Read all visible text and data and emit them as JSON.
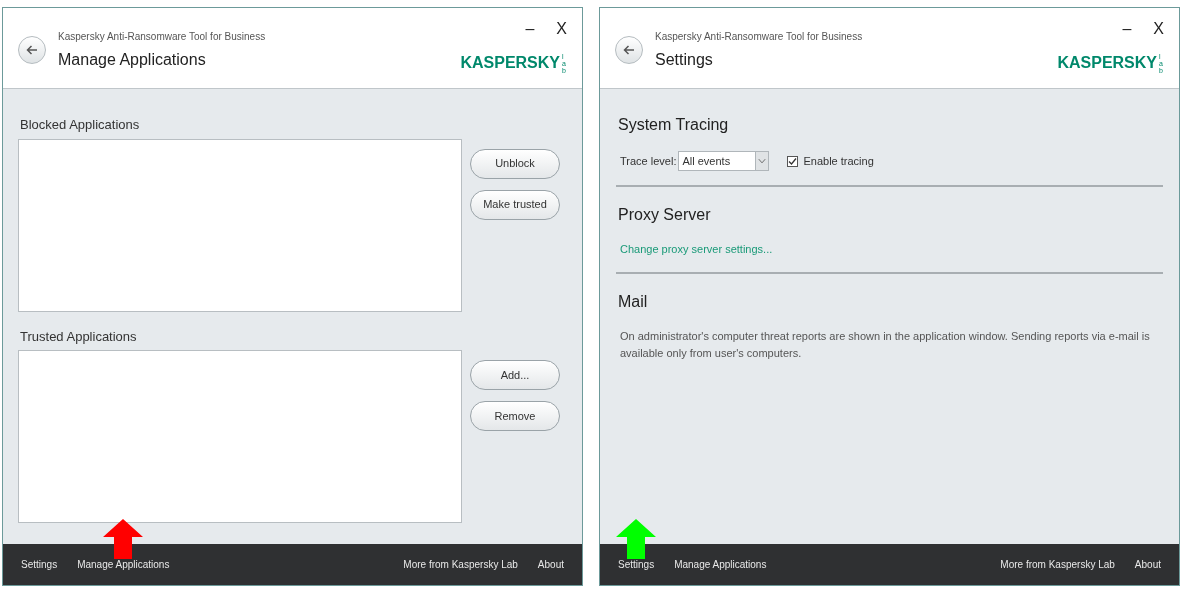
{
  "windows": [
    {
      "kind": "manage",
      "app_name": "Kaspersky Anti-Ransomware Tool for Business",
      "title": "Manage Applications",
      "logo": {
        "word": "KASPERSKY",
        "suffix": "lab"
      },
      "minimize": "–",
      "close": "X",
      "lists": [
        {
          "label": "Blocked Applications",
          "buttons": [
            "Unblock",
            "Make trusted"
          ]
        },
        {
          "label": "Trusted Applications",
          "buttons": [
            "Add...",
            "Remove"
          ]
        }
      ],
      "footer": {
        "left": [
          {
            "label": "Settings",
            "pointed": false
          },
          {
            "label": "Manage Applications",
            "pointed": true,
            "color": "#ff0000"
          }
        ],
        "right": [
          "More from Kaspersky Lab",
          "About"
        ]
      }
    },
    {
      "kind": "settings",
      "app_name": "Kaspersky Anti-Ransomware Tool for Business",
      "title": "Settings",
      "logo": {
        "word": "KASPERSKY",
        "suffix": "lab"
      },
      "minimize": "–",
      "close": "X",
      "sections": [
        {
          "kind": "tracing",
          "title": "System Tracing",
          "field_label": "Trace level:",
          "value": "All events",
          "checkbox": {
            "label": "Enable tracing",
            "checked": true
          }
        },
        {
          "kind": "link",
          "title": "Proxy Server",
          "link": "Change proxy server settings..."
        },
        {
          "kind": "text",
          "title": "Mail",
          "text": "On administrator's computer threat reports are shown in the application window. Sending reports via e-mail is available only from user's computers."
        }
      ],
      "footer": {
        "left": [
          {
            "label": "Settings",
            "pointed": true,
            "color": "#00ff00"
          },
          {
            "label": "Manage Applications",
            "pointed": false
          }
        ],
        "right": [
          "More from Kaspersky Lab",
          "About"
        ]
      }
    }
  ]
}
